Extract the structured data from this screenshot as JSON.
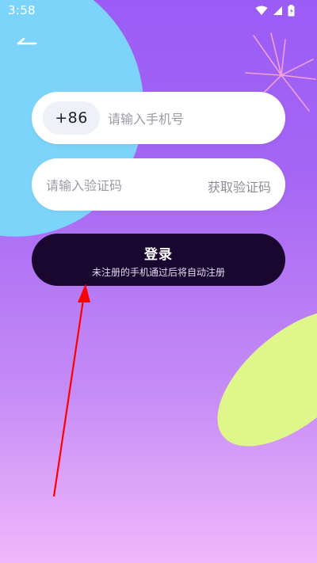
{
  "status_bar": {
    "time": "3:58",
    "icons": [
      "wifi-icon",
      "signal-icon",
      "battery-icon"
    ]
  },
  "header": {
    "back_icon": "back-arrow-icon"
  },
  "phone_field": {
    "country_code": "+86",
    "placeholder": "请输入手机号",
    "value": ""
  },
  "code_field": {
    "placeholder": "请输入验证码",
    "value": "",
    "get_code_label": "获取验证码"
  },
  "login_button": {
    "label": "登录",
    "sublabel": "未注册的手机通过后将自动注册"
  },
  "colors": {
    "background_top": "#9b5cf6",
    "background_bottom": "#f0b8fb",
    "blue_blob": "#7dd4fa",
    "green_blob": "#dff78a",
    "button_bg": "#1a0730",
    "annotation_arrow": "#ff0000"
  }
}
